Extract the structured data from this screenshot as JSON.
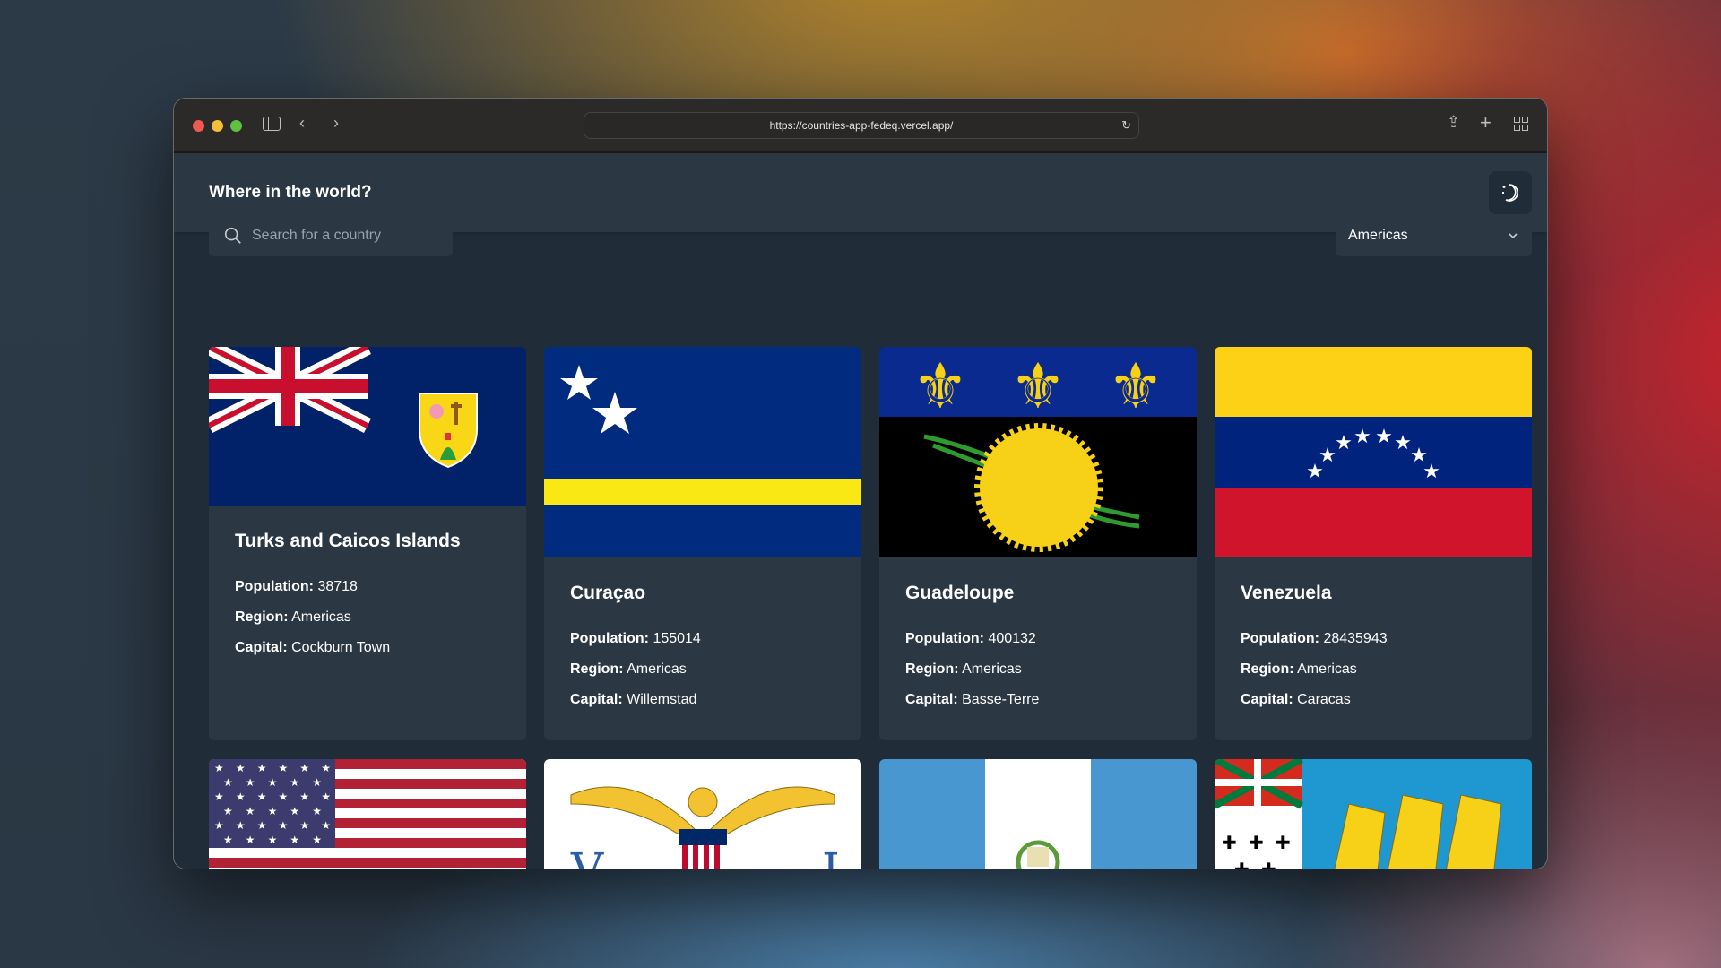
{
  "browser": {
    "url": "https://countries-app-fedeq.vercel.app/",
    "icons": [
      "sidebar-icon",
      "back-icon",
      "forward-icon",
      "reload-icon",
      "share-icon",
      "new-tab-icon",
      "tab-overview-icon"
    ]
  },
  "header": {
    "title": "Where in the world?",
    "theme_icon": "moon-stars-icon"
  },
  "search": {
    "placeholder": "Search for a country",
    "value": ""
  },
  "filter": {
    "selected": "Americas"
  },
  "labels": {
    "population": "Population:",
    "region": "Region:",
    "capital": "Capital:"
  },
  "countries": [
    {
      "name": "Turks and Caicos Islands",
      "population": "38718",
      "region": "Americas",
      "capital": "Cockburn Town"
    },
    {
      "name": "Curaçao",
      "population": "155014",
      "region": "Americas",
      "capital": "Willemstad"
    },
    {
      "name": "Guadeloupe",
      "population": "400132",
      "region": "Americas",
      "capital": "Basse-Terre"
    },
    {
      "name": "Venezuela",
      "population": "28435943",
      "region": "Americas",
      "capital": "Caracas"
    }
  ],
  "colors": {
    "background": "#202c37",
    "elements": "#2b3743",
    "text": "#ffffff"
  }
}
